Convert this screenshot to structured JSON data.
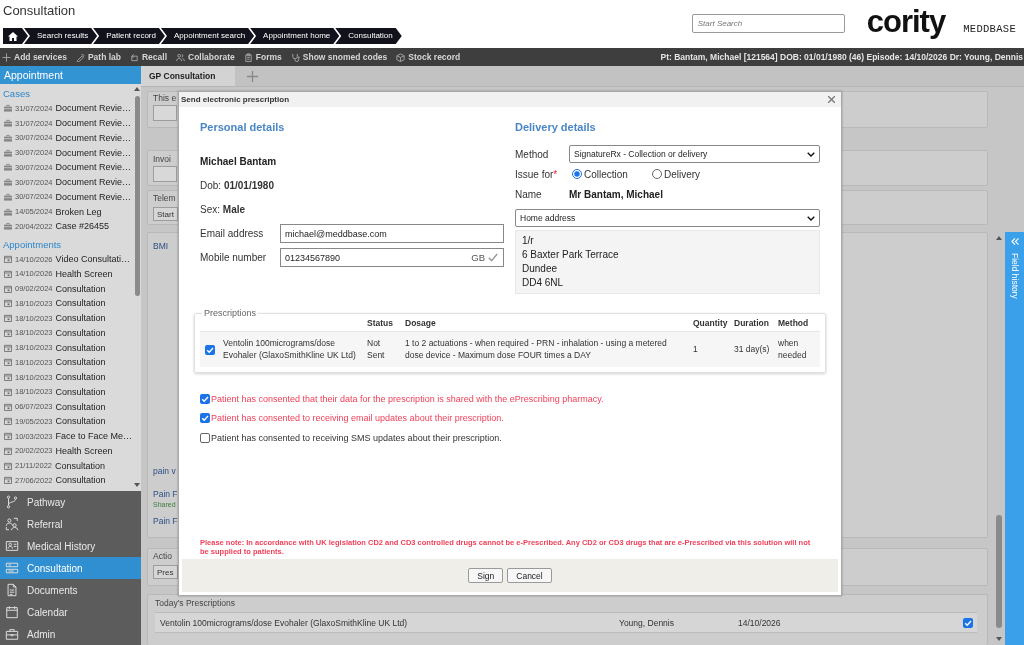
{
  "header": {
    "title": "Consultation",
    "breadcrumb": [
      "Search results",
      "Patient record",
      "Appointment search",
      "Appointment home",
      "Consultation"
    ],
    "search": {
      "placeholder": "Start Search"
    },
    "logo": {
      "brand": "cority",
      "product": "MEDDBASE"
    }
  },
  "toolbar": {
    "actions": [
      "Add services",
      "Path lab",
      "Recall",
      "Collaborate",
      "Forms",
      "Show snomed codes",
      "Stock record"
    ],
    "patient_info": "Pt: Bantam, Michael [121564] DOB: 01/01/1980 (46) Episode: 14/10/2026 Dr: Young, Dennis"
  },
  "sidebar": {
    "title": "Appointment",
    "groups": [
      {
        "heading": "Cases",
        "kind": "case",
        "items": [
          {
            "date": "31/07/2024",
            "title": "Document Revie…"
          },
          {
            "date": "31/07/2024",
            "title": "Document Revie…"
          },
          {
            "date": "30/07/2024",
            "title": "Document Revie…"
          },
          {
            "date": "30/07/2024",
            "title": "Document Revie…"
          },
          {
            "date": "30/07/2024",
            "title": "Document Revie…"
          },
          {
            "date": "30/07/2024",
            "title": "Document Revie…"
          },
          {
            "date": "30/07/2024",
            "title": "Document Revie…"
          },
          {
            "date": "14/05/2024",
            "title": "Broken Leg"
          },
          {
            "date": "20/04/2022",
            "title": "Case #26455"
          }
        ]
      },
      {
        "heading": "Appointments",
        "kind": "appointment",
        "items": [
          {
            "date": "14/10/2026",
            "title": "Video Consultati…"
          },
          {
            "date": "14/10/2026",
            "title": "Health Screen"
          },
          {
            "date": "09/02/2024",
            "title": "Consultation"
          },
          {
            "date": "18/10/2023",
            "title": "Consultation"
          },
          {
            "date": "18/10/2023",
            "title": "Consultation"
          },
          {
            "date": "18/10/2023",
            "title": "Consultation"
          },
          {
            "date": "18/10/2023",
            "title": "Consultation"
          },
          {
            "date": "18/10/2023",
            "title": "Consultation"
          },
          {
            "date": "18/10/2023",
            "title": "Consultation"
          },
          {
            "date": "18/10/2023",
            "title": "Consultation"
          },
          {
            "date": "06/07/2023",
            "title": "Consultation"
          },
          {
            "date": "19/05/2023",
            "title": "Consultation"
          },
          {
            "date": "10/03/2023",
            "title": "Face to Face Me…"
          },
          {
            "date": "20/02/2023",
            "title": "Health Screen"
          },
          {
            "date": "21/11/2022",
            "title": "Consultation"
          },
          {
            "date": "27/06/2022",
            "title": "Consultation"
          }
        ]
      }
    ],
    "nav": [
      {
        "label": "Pathway",
        "selected": false
      },
      {
        "label": "Referral",
        "selected": false
      },
      {
        "label": "Medical History",
        "selected": false
      },
      {
        "label": "Consultation",
        "selected": true
      },
      {
        "label": "Documents",
        "selected": false
      },
      {
        "label": "Calendar",
        "selected": false
      },
      {
        "label": "Admin",
        "selected": false
      }
    ]
  },
  "tabs": [
    {
      "label": "GP Consultation",
      "selected": true
    }
  ],
  "background": {
    "fields": [
      {
        "kind": "input",
        "label": "This e"
      },
      {
        "kind": "input",
        "label": "Invoi"
      },
      {
        "kind": "button",
        "label": "Telem",
        "button": "Start"
      }
    ],
    "observations": [
      {
        "text": "BMI"
      },
      {
        "text": "pain v"
      },
      {
        "text": "Pain F",
        "note": "Shared"
      },
      {
        "text": "Pain F"
      }
    ],
    "actions": {
      "label": "Actio",
      "button": "Pres"
    },
    "todays_prescriptions": {
      "title": "Today's Prescriptions",
      "rows": [
        {
          "medication": "Ventolin 100micrograms/dose Evohaler (GlaxoSmithKline UK Ltd)",
          "prescriber": "Young, Dennis",
          "date": "14/10/2026",
          "checked": true
        }
      ]
    }
  },
  "field_history": {
    "label": "Field history"
  },
  "dialog": {
    "title": "Send electronic prescription",
    "personal": {
      "heading": "Personal details",
      "name": "Michael Bantam",
      "dob": "Dob: **01/01/1980**",
      "sex": "Sex: **Male**",
      "email": {
        "label": "Email address",
        "value": "michael@meddbase.com"
      },
      "mobile": {
        "label": "Mobile number",
        "value": "01234567890",
        "country": "GB",
        "valid": true
      }
    },
    "delivery": {
      "heading": "Delivery details",
      "method": {
        "label": "Method",
        "value": "SignatureRx - Collection or delivery"
      },
      "issue_for": {
        "label": "Issue for",
        "required_mark": "*",
        "options": [
          {
            "label": "Collection",
            "selected": true
          },
          {
            "label": "Delivery",
            "selected": false
          }
        ]
      },
      "name": {
        "label": "Name",
        "value": "Mr Bantam, Michael"
      },
      "address_type": "Home address",
      "address_lines": [
        "1/r",
        "6 Baxter Park Terrace",
        "Dundee",
        "DD4 6NL"
      ]
    },
    "prescriptions": {
      "legend": "Prescriptions",
      "columns": [
        "Status",
        "Dosage",
        "Quantity",
        "Duration",
        "Method"
      ],
      "rows": [
        {
          "checked": true,
          "medication": "Ventolin 100micrograms/dose Evohaler (GlaxoSmithKline UK Ltd)",
          "status": "Not Sent",
          "dosage": "1 to 2 actuations - when required - PRN - inhalation - using a metered dose device - Maximum dose FOUR times a DAY",
          "quantity": "1",
          "duration": "31 day(s)",
          "method": "when needed"
        }
      ]
    },
    "consents": [
      {
        "text": "Patient has consented that their data for the prescription is shared with the ePrescribing pharmacy.",
        "checked": true,
        "required": true
      },
      {
        "text": "Patient has consented to receiving email updates about their prescription.",
        "checked": true,
        "required": true
      },
      {
        "text": "Patient has consented to receiving SMS updates about their prescription.",
        "checked": false,
        "required": false
      }
    ],
    "note": "Please note: In accordance with UK legislation CD2 and CD3 controlled drugs cannot be e-Prescribed. Any CD2 or CD3 drugs that are e-Prescribed via this solution will not be supplied to patients.",
    "buttons": [
      "Sign",
      "Cancel"
    ]
  }
}
